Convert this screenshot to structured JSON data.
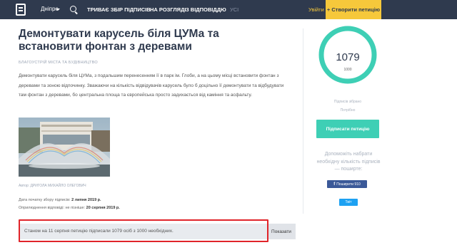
{
  "header": {
    "city": "Дніпро",
    "tabs": [
      {
        "label": "ТРИВАЄ ЗБІР ПІДПИСІВ",
        "muted": false
      },
      {
        "label": "НА РОЗГЛЯДІ",
        "muted": false
      },
      {
        "label": "З ВІДПОВІДДЮ",
        "muted": false
      },
      {
        "label": "УСІ",
        "muted": true
      }
    ],
    "login": "Увійти",
    "create_button": "+ Створити петицію"
  },
  "petition": {
    "title": "Демонтувати карусель біля ЦУМа та встановити фонтан з деревами",
    "category": "БЛАГОУСТРІЙ МІСТА ТА БУДІВНИЦТВО",
    "description": "Демонтувати карусель біля ЦУМа, з подальшим перенесенням її в парк ім. Глоби, а на цьому місці встановити фонтан з деревами та зоною відпочинку. Зважаючи на кількість відвідувачів карусель було б доцільно її демонтувати та відбудувати там фонтан з деревами, бо центральна площа та європейська просто задихається від каміння та асфальту.",
    "photo_author": "Автор: ДРИГОЛА МИХАЙЛО ОЛЕГОВИЧ",
    "start_label": "Дата початку збору підписів:",
    "start_date": "2 липня 2019 р.",
    "reply_label": "Оприлюднення відповіді: не пізніше:",
    "reply_date": "20 серпня 2019 р.",
    "status_text": "Станом на 11 серпня петицію підписали 1079 осіб з 1000 необхідних.",
    "show_button": "Показати"
  },
  "sidebar": {
    "count": "1079",
    "goal": "1000",
    "progress": 1.0,
    "collected_label": "Підписів зібрано",
    "needed_label": "Потрібно",
    "sign_button": "Підписати петицію",
    "help_text": "Допоможіть набрати необхідну кількість підписів — поширте:",
    "facebook_button": "Поширити 910",
    "twitter_button": "Твіт"
  },
  "colors": {
    "header_bg": "#2f3a4e",
    "accent_yellow": "#f6c83b",
    "accent_teal": "#3ecfb5",
    "highlight_red": "#e0242a",
    "facebook": "#3b5998",
    "twitter": "#1da1f2"
  },
  "icons": {
    "logo": "petition-logo-icon",
    "search": "search-icon",
    "caret": "chevron-down-icon",
    "facebook": "facebook-icon",
    "twitter": "twitter-icon"
  }
}
